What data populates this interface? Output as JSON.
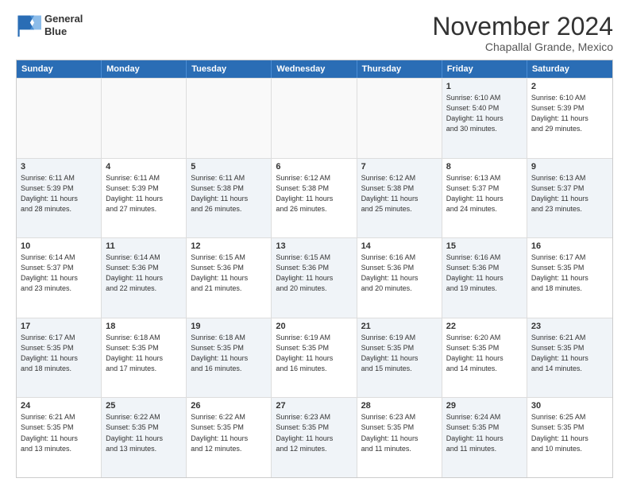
{
  "logo": {
    "line1": "General",
    "line2": "Blue"
  },
  "title": "November 2024",
  "location": "Chapallal Grande, Mexico",
  "header_days": [
    "Sunday",
    "Monday",
    "Tuesday",
    "Wednesday",
    "Thursday",
    "Friday",
    "Saturday"
  ],
  "rows": [
    [
      {
        "day": "",
        "info": "",
        "empty": true
      },
      {
        "day": "",
        "info": "",
        "empty": true
      },
      {
        "day": "",
        "info": "",
        "empty": true
      },
      {
        "day": "",
        "info": "",
        "empty": true
      },
      {
        "day": "",
        "info": "",
        "empty": true
      },
      {
        "day": "1",
        "info": "Sunrise: 6:10 AM\nSunset: 5:40 PM\nDaylight: 11 hours\nand 30 minutes.",
        "shaded": true
      },
      {
        "day": "2",
        "info": "Sunrise: 6:10 AM\nSunset: 5:39 PM\nDaylight: 11 hours\nand 29 minutes.",
        "shaded": false
      }
    ],
    [
      {
        "day": "3",
        "info": "Sunrise: 6:11 AM\nSunset: 5:39 PM\nDaylight: 11 hours\nand 28 minutes.",
        "shaded": true
      },
      {
        "day": "4",
        "info": "Sunrise: 6:11 AM\nSunset: 5:39 PM\nDaylight: 11 hours\nand 27 minutes.",
        "shaded": false
      },
      {
        "day": "5",
        "info": "Sunrise: 6:11 AM\nSunset: 5:38 PM\nDaylight: 11 hours\nand 26 minutes.",
        "shaded": true
      },
      {
        "day": "6",
        "info": "Sunrise: 6:12 AM\nSunset: 5:38 PM\nDaylight: 11 hours\nand 26 minutes.",
        "shaded": false
      },
      {
        "day": "7",
        "info": "Sunrise: 6:12 AM\nSunset: 5:38 PM\nDaylight: 11 hours\nand 25 minutes.",
        "shaded": true
      },
      {
        "day": "8",
        "info": "Sunrise: 6:13 AM\nSunset: 5:37 PM\nDaylight: 11 hours\nand 24 minutes.",
        "shaded": false
      },
      {
        "day": "9",
        "info": "Sunrise: 6:13 AM\nSunset: 5:37 PM\nDaylight: 11 hours\nand 23 minutes.",
        "shaded": true
      }
    ],
    [
      {
        "day": "10",
        "info": "Sunrise: 6:14 AM\nSunset: 5:37 PM\nDaylight: 11 hours\nand 23 minutes.",
        "shaded": false
      },
      {
        "day": "11",
        "info": "Sunrise: 6:14 AM\nSunset: 5:36 PM\nDaylight: 11 hours\nand 22 minutes.",
        "shaded": true
      },
      {
        "day": "12",
        "info": "Sunrise: 6:15 AM\nSunset: 5:36 PM\nDaylight: 11 hours\nand 21 minutes.",
        "shaded": false
      },
      {
        "day": "13",
        "info": "Sunrise: 6:15 AM\nSunset: 5:36 PM\nDaylight: 11 hours\nand 20 minutes.",
        "shaded": true
      },
      {
        "day": "14",
        "info": "Sunrise: 6:16 AM\nSunset: 5:36 PM\nDaylight: 11 hours\nand 20 minutes.",
        "shaded": false
      },
      {
        "day": "15",
        "info": "Sunrise: 6:16 AM\nSunset: 5:36 PM\nDaylight: 11 hours\nand 19 minutes.",
        "shaded": true
      },
      {
        "day": "16",
        "info": "Sunrise: 6:17 AM\nSunset: 5:35 PM\nDaylight: 11 hours\nand 18 minutes.",
        "shaded": false
      }
    ],
    [
      {
        "day": "17",
        "info": "Sunrise: 6:17 AM\nSunset: 5:35 PM\nDaylight: 11 hours\nand 18 minutes.",
        "shaded": true
      },
      {
        "day": "18",
        "info": "Sunrise: 6:18 AM\nSunset: 5:35 PM\nDaylight: 11 hours\nand 17 minutes.",
        "shaded": false
      },
      {
        "day": "19",
        "info": "Sunrise: 6:18 AM\nSunset: 5:35 PM\nDaylight: 11 hours\nand 16 minutes.",
        "shaded": true
      },
      {
        "day": "20",
        "info": "Sunrise: 6:19 AM\nSunset: 5:35 PM\nDaylight: 11 hours\nand 16 minutes.",
        "shaded": false
      },
      {
        "day": "21",
        "info": "Sunrise: 6:19 AM\nSunset: 5:35 PM\nDaylight: 11 hours\nand 15 minutes.",
        "shaded": true
      },
      {
        "day": "22",
        "info": "Sunrise: 6:20 AM\nSunset: 5:35 PM\nDaylight: 11 hours\nand 14 minutes.",
        "shaded": false
      },
      {
        "day": "23",
        "info": "Sunrise: 6:21 AM\nSunset: 5:35 PM\nDaylight: 11 hours\nand 14 minutes.",
        "shaded": true
      }
    ],
    [
      {
        "day": "24",
        "info": "Sunrise: 6:21 AM\nSunset: 5:35 PM\nDaylight: 11 hours\nand 13 minutes.",
        "shaded": false
      },
      {
        "day": "25",
        "info": "Sunrise: 6:22 AM\nSunset: 5:35 PM\nDaylight: 11 hours\nand 13 minutes.",
        "shaded": true
      },
      {
        "day": "26",
        "info": "Sunrise: 6:22 AM\nSunset: 5:35 PM\nDaylight: 11 hours\nand 12 minutes.",
        "shaded": false
      },
      {
        "day": "27",
        "info": "Sunrise: 6:23 AM\nSunset: 5:35 PM\nDaylight: 11 hours\nand 12 minutes.",
        "shaded": true
      },
      {
        "day": "28",
        "info": "Sunrise: 6:23 AM\nSunset: 5:35 PM\nDaylight: 11 hours\nand 11 minutes.",
        "shaded": false
      },
      {
        "day": "29",
        "info": "Sunrise: 6:24 AM\nSunset: 5:35 PM\nDaylight: 11 hours\nand 11 minutes.",
        "shaded": true
      },
      {
        "day": "30",
        "info": "Sunrise: 6:25 AM\nSunset: 5:35 PM\nDaylight: 11 hours\nand 10 minutes.",
        "shaded": false
      }
    ]
  ]
}
